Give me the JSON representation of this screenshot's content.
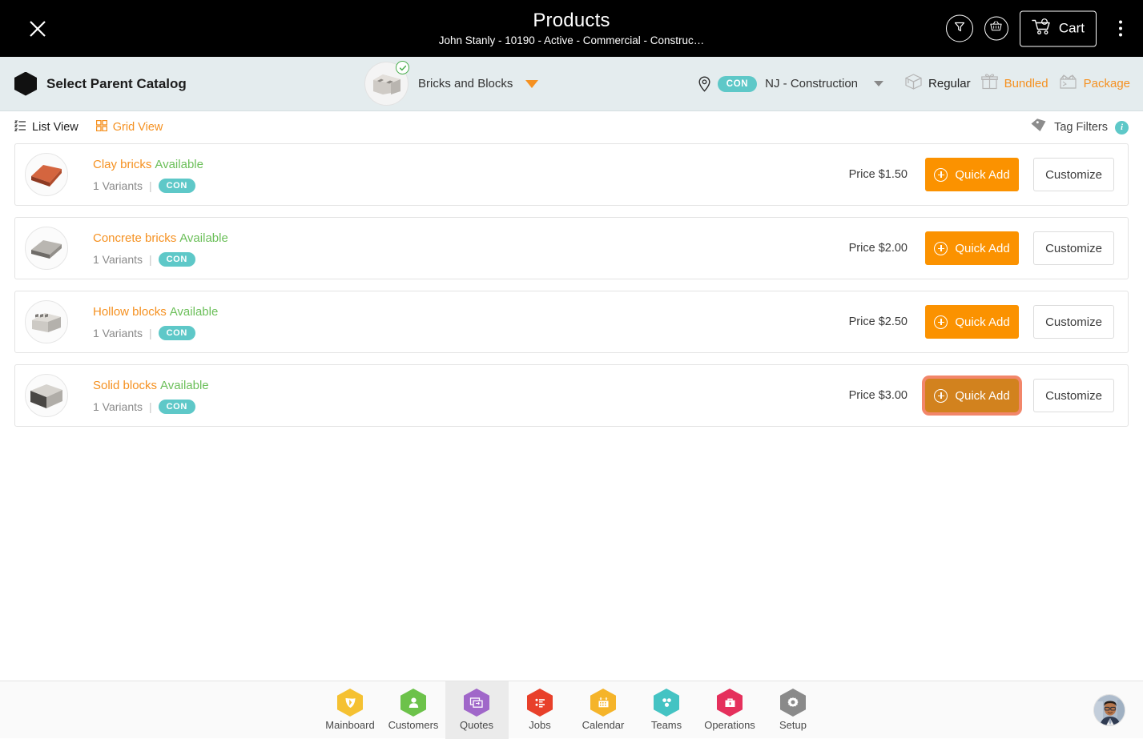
{
  "header": {
    "close_icon": "close-icon",
    "title": "Products",
    "subtitle": "John Stanly - 10190 - Active - Commercial - Construc…",
    "filter_icon": "funnel-icon",
    "basket_icon": "add-to-basket-icon",
    "cart_label": "Cart",
    "cart_icon": "shopping-cart-icon",
    "overflow_icon": "kebab-menu-icon"
  },
  "catalog_bar": {
    "parent_catalog_label": "Select Parent Catalog",
    "parent_catalog_icon": "hexagon-icon",
    "selected_catalog": "Bricks and Blocks",
    "catalog_check_icon": "check-circle-icon",
    "catalog_caret_icon": "chevron-down-icon",
    "location_icon": "map-pin-icon",
    "location_tag": "CON",
    "location_name": "NJ - Construction",
    "location_caret_icon": "caret-down-icon",
    "modes": [
      {
        "label": "Regular",
        "icon": "box-icon",
        "active": true
      },
      {
        "label": "Bundled",
        "icon": "gift-icon",
        "active": false
      },
      {
        "label": "Package",
        "icon": "package-icon",
        "active": false
      }
    ]
  },
  "view_row": {
    "list_view_label": "List View",
    "list_view_icon": "list-view-icon",
    "grid_view_label": "Grid View",
    "grid_view_icon": "grid-view-icon",
    "tag_filters_label": "Tag Filters",
    "tag_filters_icon": "tag-icon",
    "tag_filters_info_icon": "info-icon",
    "info_glyph": "i"
  },
  "products": {
    "variants_suffix": "1 Variants",
    "separator": "|",
    "availability": "Available",
    "tag": "CON",
    "quick_add_label": "Quick Add",
    "customize_label": "Customize",
    "items": [
      {
        "name": "Clay bricks",
        "availability": "Available",
        "variants": "1 Variants",
        "tag": "CON",
        "price": "Price $1.50",
        "thumb": "clay-brick-thumb",
        "focused": false
      },
      {
        "name": "Concrete bricks",
        "availability": "Available",
        "variants": "1 Variants",
        "tag": "CON",
        "price": "Price $2.00",
        "thumb": "concrete-brick-thumb",
        "focused": false
      },
      {
        "name": "Hollow blocks",
        "availability": "Available",
        "variants": "1 Variants",
        "tag": "CON",
        "price": "Price $2.50",
        "thumb": "hollow-block-thumb",
        "focused": false
      },
      {
        "name": "Solid blocks",
        "availability": "Available",
        "variants": "1 Variants",
        "tag": "CON",
        "price": "Price $3.00",
        "thumb": "solid-block-thumb",
        "focused": true
      }
    ]
  },
  "bottom_nav": {
    "items": [
      {
        "label": "Mainboard",
        "icon": "mainboard-icon",
        "color": "#f5c132",
        "current": false
      },
      {
        "label": "Customers",
        "icon": "customers-icon",
        "color": "#6cc24a",
        "current": false
      },
      {
        "label": "Quotes",
        "icon": "quotes-icon",
        "color": "#a067c9",
        "current": true
      },
      {
        "label": "Jobs",
        "icon": "jobs-icon",
        "color": "#e8402a",
        "current": false
      },
      {
        "label": "Calendar",
        "icon": "calendar-icon",
        "color": "#f5b42a",
        "current": false
      },
      {
        "label": "Teams",
        "icon": "teams-icon",
        "color": "#44c3c3",
        "current": false
      },
      {
        "label": "Operations",
        "icon": "operations-icon",
        "color": "#e5305c",
        "current": false
      },
      {
        "label": "Setup",
        "icon": "setup-icon",
        "color": "#8a8a8a",
        "current": false
      }
    ],
    "avatar_icon": "user-avatar"
  },
  "colors": {
    "accent_orange": "#f59121",
    "button_orange": "#fb9200",
    "focus_ring": "#f2866a",
    "focused_button": "#d2821e",
    "teal": "#5ec8c8",
    "green": "#6bbf59",
    "header_bg": "#000000",
    "catalog_bg": "#e4ecee"
  }
}
